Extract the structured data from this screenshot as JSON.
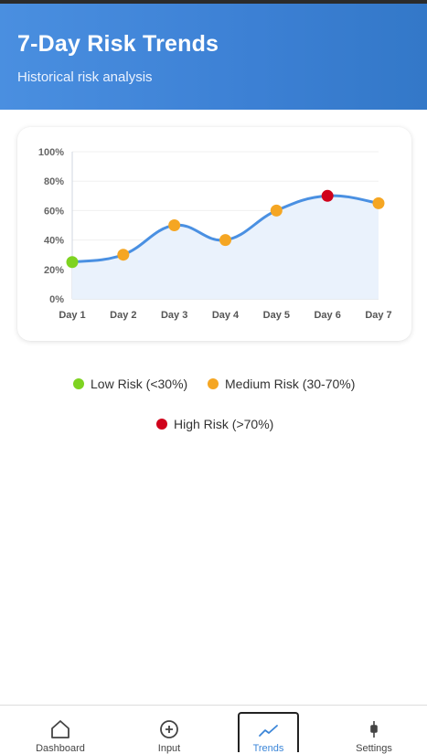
{
  "header": {
    "title": "7-Day Risk Trends",
    "subtitle": "Historical risk analysis"
  },
  "chart_data": {
    "type": "line",
    "categories": [
      "Day 1",
      "Day 2",
      "Day 3",
      "Day 4",
      "Day 5",
      "Day 6",
      "Day 7"
    ],
    "series": [
      {
        "values": [
          25,
          30,
          50,
          40,
          60,
          70,
          65
        ]
      }
    ],
    "point_colors": [
      "#7ed321",
      "#f5a623",
      "#f5a623",
      "#f5a623",
      "#f5a623",
      "#d0021b",
      "#f5a623"
    ],
    "yticks": [
      "0%",
      "20%",
      "40%",
      "60%",
      "80%",
      "100%"
    ],
    "ylim": [
      0,
      100
    ],
    "line_color": "#4a90e2",
    "fill_color": "#eaf2fc",
    "grid": true
  },
  "legend": [
    {
      "label": "Low Risk (<30%)",
      "color": "#7ed321"
    },
    {
      "label": "Medium Risk (30-70%)",
      "color": "#f5a623"
    },
    {
      "label": "High Risk (>70%)",
      "color": "#d0021b"
    }
  ],
  "nav": {
    "items": [
      {
        "label": "Dashboard",
        "icon": "home-icon"
      },
      {
        "label": "Input",
        "icon": "plus-circle-icon"
      },
      {
        "label": "Trends",
        "icon": "trend-line-icon",
        "active": true
      },
      {
        "label": "Settings",
        "icon": "settings-icon"
      }
    ],
    "active_color": "#3b86d8"
  }
}
